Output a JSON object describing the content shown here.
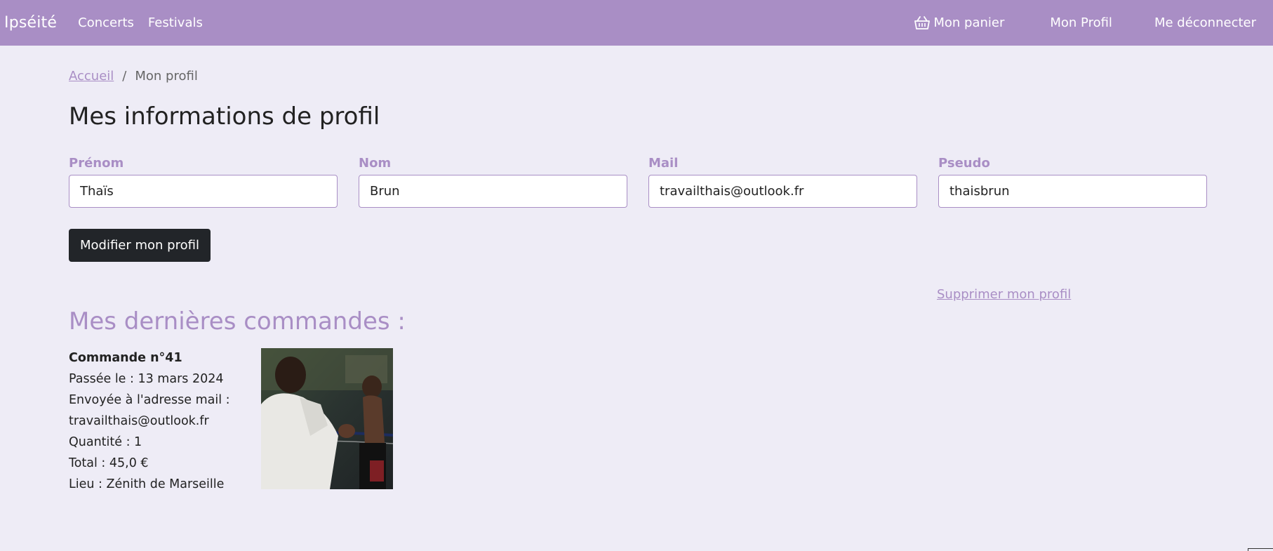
{
  "nav": {
    "brand": "Ipséité",
    "links": [
      "Concerts",
      "Festivals"
    ],
    "cart": "Mon panier",
    "profile": "Mon Profil",
    "logout": "Me déconnecter"
  },
  "breadcrumb": {
    "home": "Accueil",
    "sep": "/",
    "current": "Mon profil"
  },
  "profile": {
    "title": "Mes informations de profil",
    "fields": [
      {
        "label": "Prénom",
        "value": "Thaïs"
      },
      {
        "label": "Nom",
        "value": "Brun"
      },
      {
        "label": "Mail",
        "value": "travailthais@outlook.fr"
      },
      {
        "label": "Pseudo",
        "value": "thaisbrun"
      }
    ],
    "edit_button": "Modifier mon profil",
    "delete_link": "Supprimer mon profil"
  },
  "orders": {
    "title": "Mes dernières commandes :",
    "items": [
      {
        "number": "Commande n°41",
        "date": "Passée le : 13 mars 2024",
        "sent_to_label": "Envoyée à l'adresse mail :",
        "email": "travailthais@outlook.fr",
        "quantity": "Quantité : 1",
        "total": "Total : 45,0 €",
        "place": "Lieu : Zénith de Marseille"
      }
    ]
  },
  "colors": {
    "accent": "#a98ec5",
    "background": "#eeecf6",
    "button": "#222529"
  }
}
